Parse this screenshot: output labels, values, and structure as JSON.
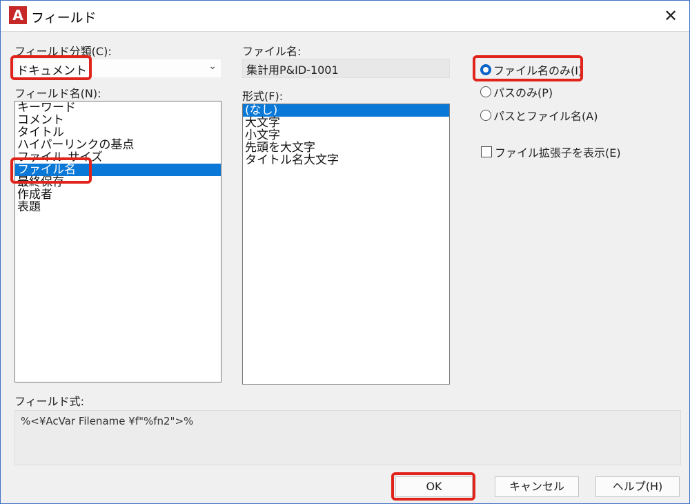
{
  "window": {
    "title": "フィールド",
    "app_icon_letter": "A",
    "close_glyph": "✕"
  },
  "category": {
    "label": "フィールド分類(C):",
    "value": "ドキュメント",
    "arrow": "⌄"
  },
  "field_names": {
    "label": "フィールド名(N):",
    "items": [
      "キーワード",
      "コメント",
      "タイトル",
      "ハイパーリンクの基点",
      "ファイル サイズ",
      "ファイル名",
      "最終保存",
      "作成者",
      "表題"
    ],
    "selected_index": 5
  },
  "file_name": {
    "label": "ファイル名:",
    "value": "集計用P&ID-1001"
  },
  "format": {
    "label": "形式(F):",
    "items": [
      "(なし)",
      "大文字",
      "小文字",
      "先頭を大文字",
      "タイトル名大文字"
    ],
    "selected_index": 0
  },
  "options": {
    "radio_filename_only": "ファイル名のみ(I)",
    "radio_path_only": "パスのみ(P)",
    "radio_path_and_filename": "パスとファイル名(A)",
    "checkbox_show_extension": "ファイル拡張子を表示(E)"
  },
  "expression": {
    "label": "フィールド式:",
    "value": "%<¥AcVar Filename ¥f\"%fn2\">%"
  },
  "buttons": {
    "ok": "OK",
    "cancel": "キャンセル",
    "help": "ヘルプ(H)"
  },
  "colors": {
    "selection": "#0a78d7",
    "highlight": "#e0241b",
    "radio_checked": "#0a64c8"
  }
}
